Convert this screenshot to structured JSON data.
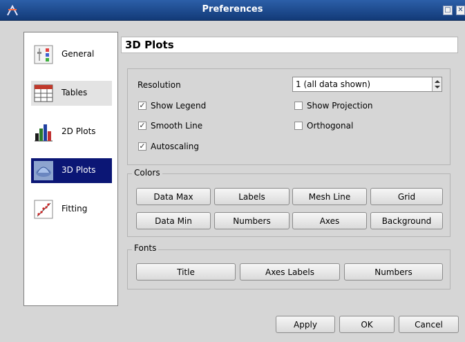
{
  "window": {
    "title": "Preferences"
  },
  "sidebar": {
    "items": [
      {
        "label": "General"
      },
      {
        "label": "Tables"
      },
      {
        "label": "2D Plots"
      },
      {
        "label": "3D Plots"
      },
      {
        "label": "Fitting"
      }
    ]
  },
  "page": {
    "title": "3D Plots"
  },
  "options": {
    "resolution_label": "Resolution",
    "resolution_value": "1 (all data shown)",
    "show_legend": {
      "label": "Show Legend",
      "checked": true
    },
    "smooth_line": {
      "label": "Smooth Line",
      "checked": true
    },
    "autoscaling": {
      "label": "Autoscaling",
      "checked": true
    },
    "show_projection": {
      "label": "Show Projection",
      "checked": false
    },
    "orthogonal": {
      "label": "Orthogonal",
      "checked": false
    }
  },
  "colors": {
    "legend": "Colors",
    "buttons": [
      "Data Max",
      "Labels",
      "Mesh Line",
      "Grid",
      "Data Min",
      "Numbers",
      "Axes",
      "Background"
    ]
  },
  "fonts": {
    "legend": "Fonts",
    "buttons": [
      "Title",
      "Axes Labels",
      "Numbers"
    ]
  },
  "footer": {
    "apply": "Apply",
    "ok": "OK",
    "cancel": "Cancel"
  },
  "check_mark": "✓",
  "accent": {
    "titlebar": "#1e4b8f",
    "selection": "#0b1675"
  }
}
